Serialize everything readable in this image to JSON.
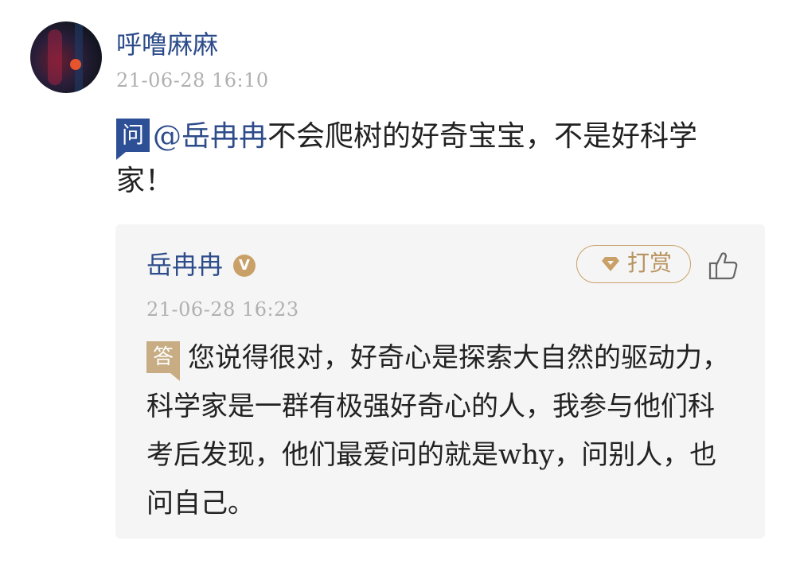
{
  "comment": {
    "user": "呼噜麻麻",
    "time": "21-06-28 16:10",
    "tag": "问",
    "mention": "@岳冉冉",
    "text": "不会爬树的好奇宝宝，不是好科学家！"
  },
  "reply": {
    "user": "岳冉冉",
    "verified_badge": "V",
    "tip_label": "打赏",
    "like_icon": "thumbs-up-icon",
    "time": "21-06-28 16:23",
    "tag": "答",
    "text": "您说得很对，好奇心是探索大自然的驱动力，科学家是一群有极强好奇心的人，我参与他们科考后发现，他们最爱问的就是why，问别人，也问自己。"
  },
  "colors": {
    "link_blue": "#2d4c8a",
    "question_tag": "#2d4f95",
    "answer_tag": "#c8ad84",
    "gold": "#c9a168",
    "card_bg": "#f5f5f5",
    "muted": "#b0b0b0"
  }
}
